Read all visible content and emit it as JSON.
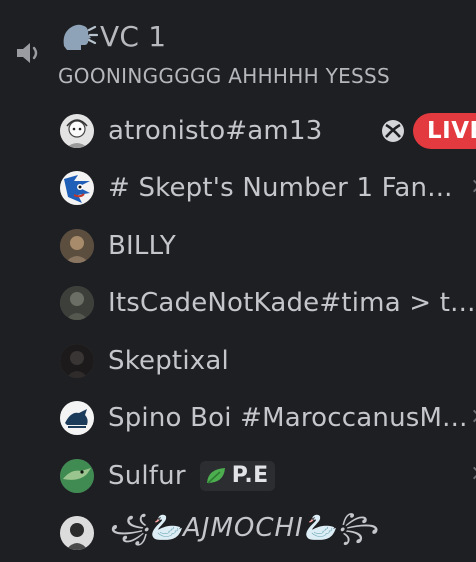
{
  "channel": {
    "emoji": "speaking-head-icon",
    "name": "VC 1",
    "status": "GOONINGGGGG AHHHHH YESSS"
  },
  "users": [
    {
      "name": "atronisto#am13",
      "avatar_color": "#d8d8d8",
      "platform_icon": "xbox-icon",
      "live_label": "LIVE"
    },
    {
      "name": "# Skept's Number 1 Fan...",
      "avatar_color": "#1f5fb8"
    },
    {
      "name": "BILLY",
      "avatar_color": "#7a6a58"
    },
    {
      "name": "ItsCadeNotKade#tima > t...",
      "avatar_color": "#4a4d45"
    },
    {
      "name": "Skeptixal",
      "avatar_color": "#2c2a2a"
    },
    {
      "name": "Spino Boi #MaroccanusM...",
      "avatar_color": "#f2f2f2"
    },
    {
      "name": "Sulfur",
      "avatar_color": "#5aa86a",
      "tag_label": "P.E",
      "tag_icon": "leaf-icon"
    },
    {
      "name": "꧁🦢AJMOCHI🦢꧂",
      "avatar_color": "#e8e8e8"
    }
  ],
  "colors": {
    "background": "#1e1f22",
    "live_badge": "#e23a3f",
    "text": "#c4c6cc"
  }
}
